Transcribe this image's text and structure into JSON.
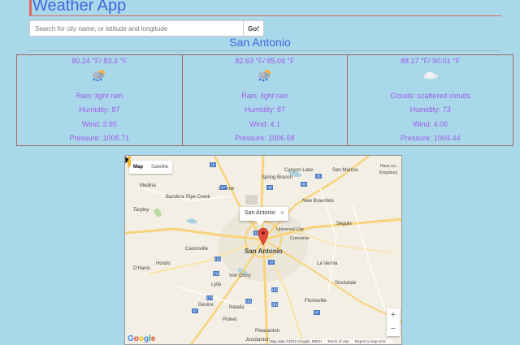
{
  "app": {
    "title": "Weather App"
  },
  "search": {
    "placeholder": "Search for city name, or latitude and longitude",
    "value": "",
    "button": "Go!"
  },
  "city": "San Antonio",
  "forecast": [
    {
      "temp": "80.24 °F/ 83.3 °F",
      "icon": "rain-cloud-icon",
      "condition": "Rain: light rain",
      "humidity": "Humidity: 87",
      "wind": "Wind: 3.95",
      "pressure": "Pressure: 1006.71"
    },
    {
      "temp": "82.63 °F/ 85.08 °F",
      "icon": "rain-cloud-icon",
      "condition": "Rain: light rain",
      "humidity": "Humidity: 87",
      "wind": "Wind: 4.1",
      "pressure": "Pressure: 1006.68"
    },
    {
      "temp": "88.17 °F/ 90.01 °F",
      "icon": "cloud-icon",
      "condition": "Clouds: scattered clouds",
      "humidity": "Humidity: 73",
      "wind": "Wind: 4.06",
      "pressure": "Pressure: 1004.44"
    }
  ],
  "map": {
    "type_buttons": [
      "Map",
      "Satellite"
    ],
    "active_type": "Map",
    "marker_label": "San Antonio",
    "info_window": "San Antonio",
    "zoom_in": "+",
    "zoom_out": "−",
    "logo": "Google",
    "attribution": [
      "Map data ©2016 Google, INEGI",
      "Terms of Use",
      "Report a map error"
    ],
    "places": [
      "Medina",
      "Bandera",
      "Pipe Creek",
      "Tarpley",
      "Boerne",
      "Canyon Lake",
      "San Marcos",
      "New Braunfels",
      "Spring Branch",
      "Seguin",
      "Universal City",
      "Converse",
      "Hondo",
      "Castroville",
      "D'Hanis",
      "Von Ormy",
      "Lytle",
      "La Vernia",
      "Stockdale",
      "Devine",
      "Floresville",
      "Pleasanton",
      "Jourdanton",
      "Poteet",
      "Natalia",
      "Have no...",
      "Kingsbury"
    ],
    "highways": [
      "10",
      "16",
      "46",
      "90",
      "35",
      "87",
      "37",
      "123",
      "181",
      "173",
      "132",
      "281",
      "97",
      "211",
      "97"
    ]
  },
  "colors": {
    "background": "#a8d8ea",
    "accent": "#3f66e0",
    "card_text": "#a05ce8",
    "border": "#a4685f"
  }
}
